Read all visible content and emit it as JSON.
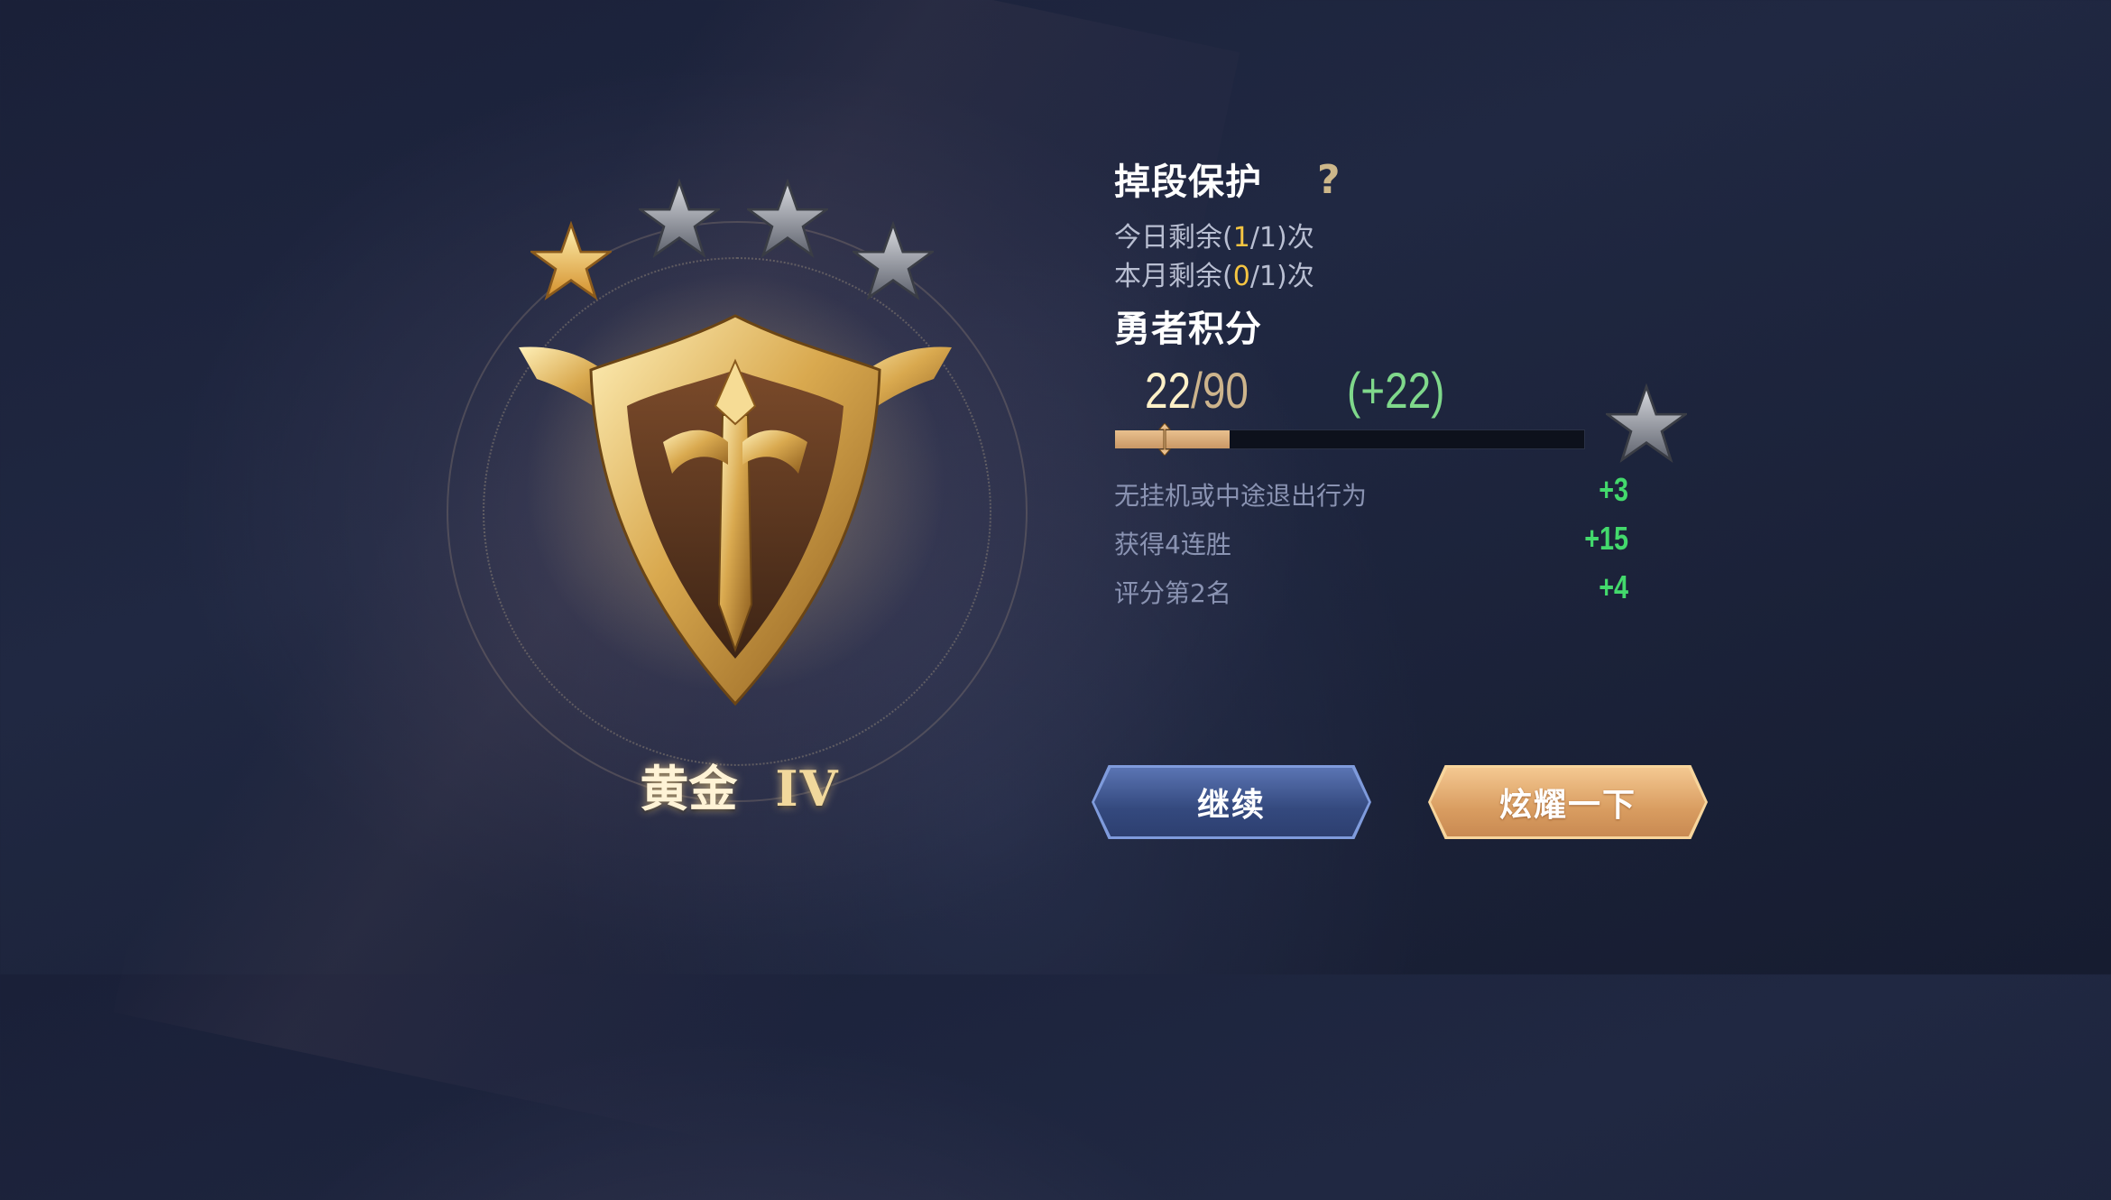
{
  "rank": {
    "name": "黄金",
    "tier": "IV",
    "stars_filled": 1,
    "stars_total": 4
  },
  "protection": {
    "title": "掉段保护",
    "help_icon": "question-mark-icon",
    "today": {
      "prefix": "今日剩余(",
      "used": "1",
      "sep": "/1)",
      "suffix": "次"
    },
    "month": {
      "prefix": "本月剩余(",
      "used": "0",
      "sep": "/1)",
      "suffix": "次"
    }
  },
  "brave_points": {
    "title": "勇者积分",
    "current": "22",
    "slash": "/",
    "total": "90",
    "gain": "(+22)",
    "progress_fraction": 0.244
  },
  "bonuses": [
    {
      "label": "无挂机或中途退出行为",
      "value": "+3"
    },
    {
      "label": "获得4连胜",
      "value": "+15"
    },
    {
      "label": "评分第2名",
      "value": "+4"
    }
  ],
  "buttons": {
    "continue": "继续",
    "share": "炫耀一下"
  },
  "colors": {
    "highlight": "#f5c542",
    "gain_green": "#7fd88b",
    "bonus_green": "#43d96c",
    "gold": "#f1d89c"
  }
}
